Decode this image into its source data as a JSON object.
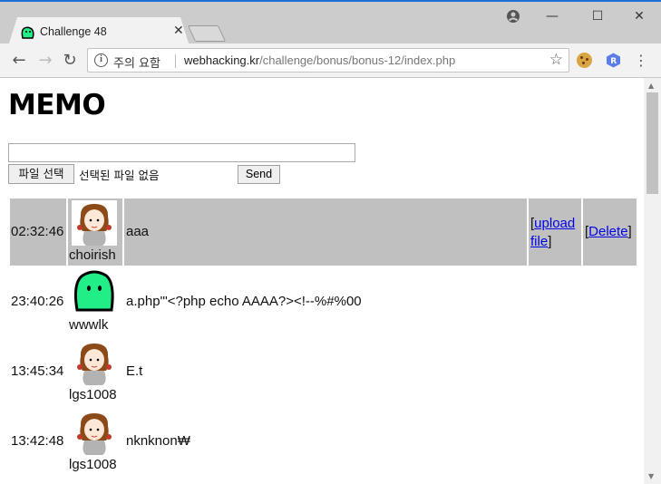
{
  "browser": {
    "tab_title": "Challenge 48",
    "security_label": "주의 요함",
    "url_host": "webhacking.kr",
    "url_path": "/challenge/bonus/bonus-12/index.php",
    "icons": [
      "back-icon",
      "forward-icon",
      "reload-icon",
      "info-icon",
      "star-icon",
      "menu-icon",
      "account-icon",
      "minimize-icon",
      "maximize-icon",
      "close-icon"
    ]
  },
  "page": {
    "heading": "MEMO",
    "memo_input_value": "",
    "file_button": "파일 선택",
    "file_status": "선택된 파일 없음",
    "send_button": "Send"
  },
  "rows": [
    {
      "time": "02:32:46",
      "user": "choirish",
      "avatar": "girl",
      "memo": "aaa",
      "upload_open": "[",
      "upload_link1": "upload",
      "upload_link2": "file",
      "upload_close": "]",
      "delete_open": "[",
      "delete_link": "Delete",
      "delete_close": "]"
    },
    {
      "time": "23:40:26",
      "user": "wwwlk",
      "avatar": "slime",
      "memo": "a.php'\"<?php echo AAAA?><!--%#%00"
    },
    {
      "time": "13:45:34",
      "user": "lgs1008",
      "avatar": "girl",
      "memo": "E.t"
    },
    {
      "time": "13:42:48",
      "user": "lgs1008",
      "avatar": "girl",
      "memo": "nknknon₩"
    }
  ],
  "colors": {
    "highlight_row": "#c0c0c0",
    "link": "#0000ee",
    "slime_green": "#22ee88"
  }
}
